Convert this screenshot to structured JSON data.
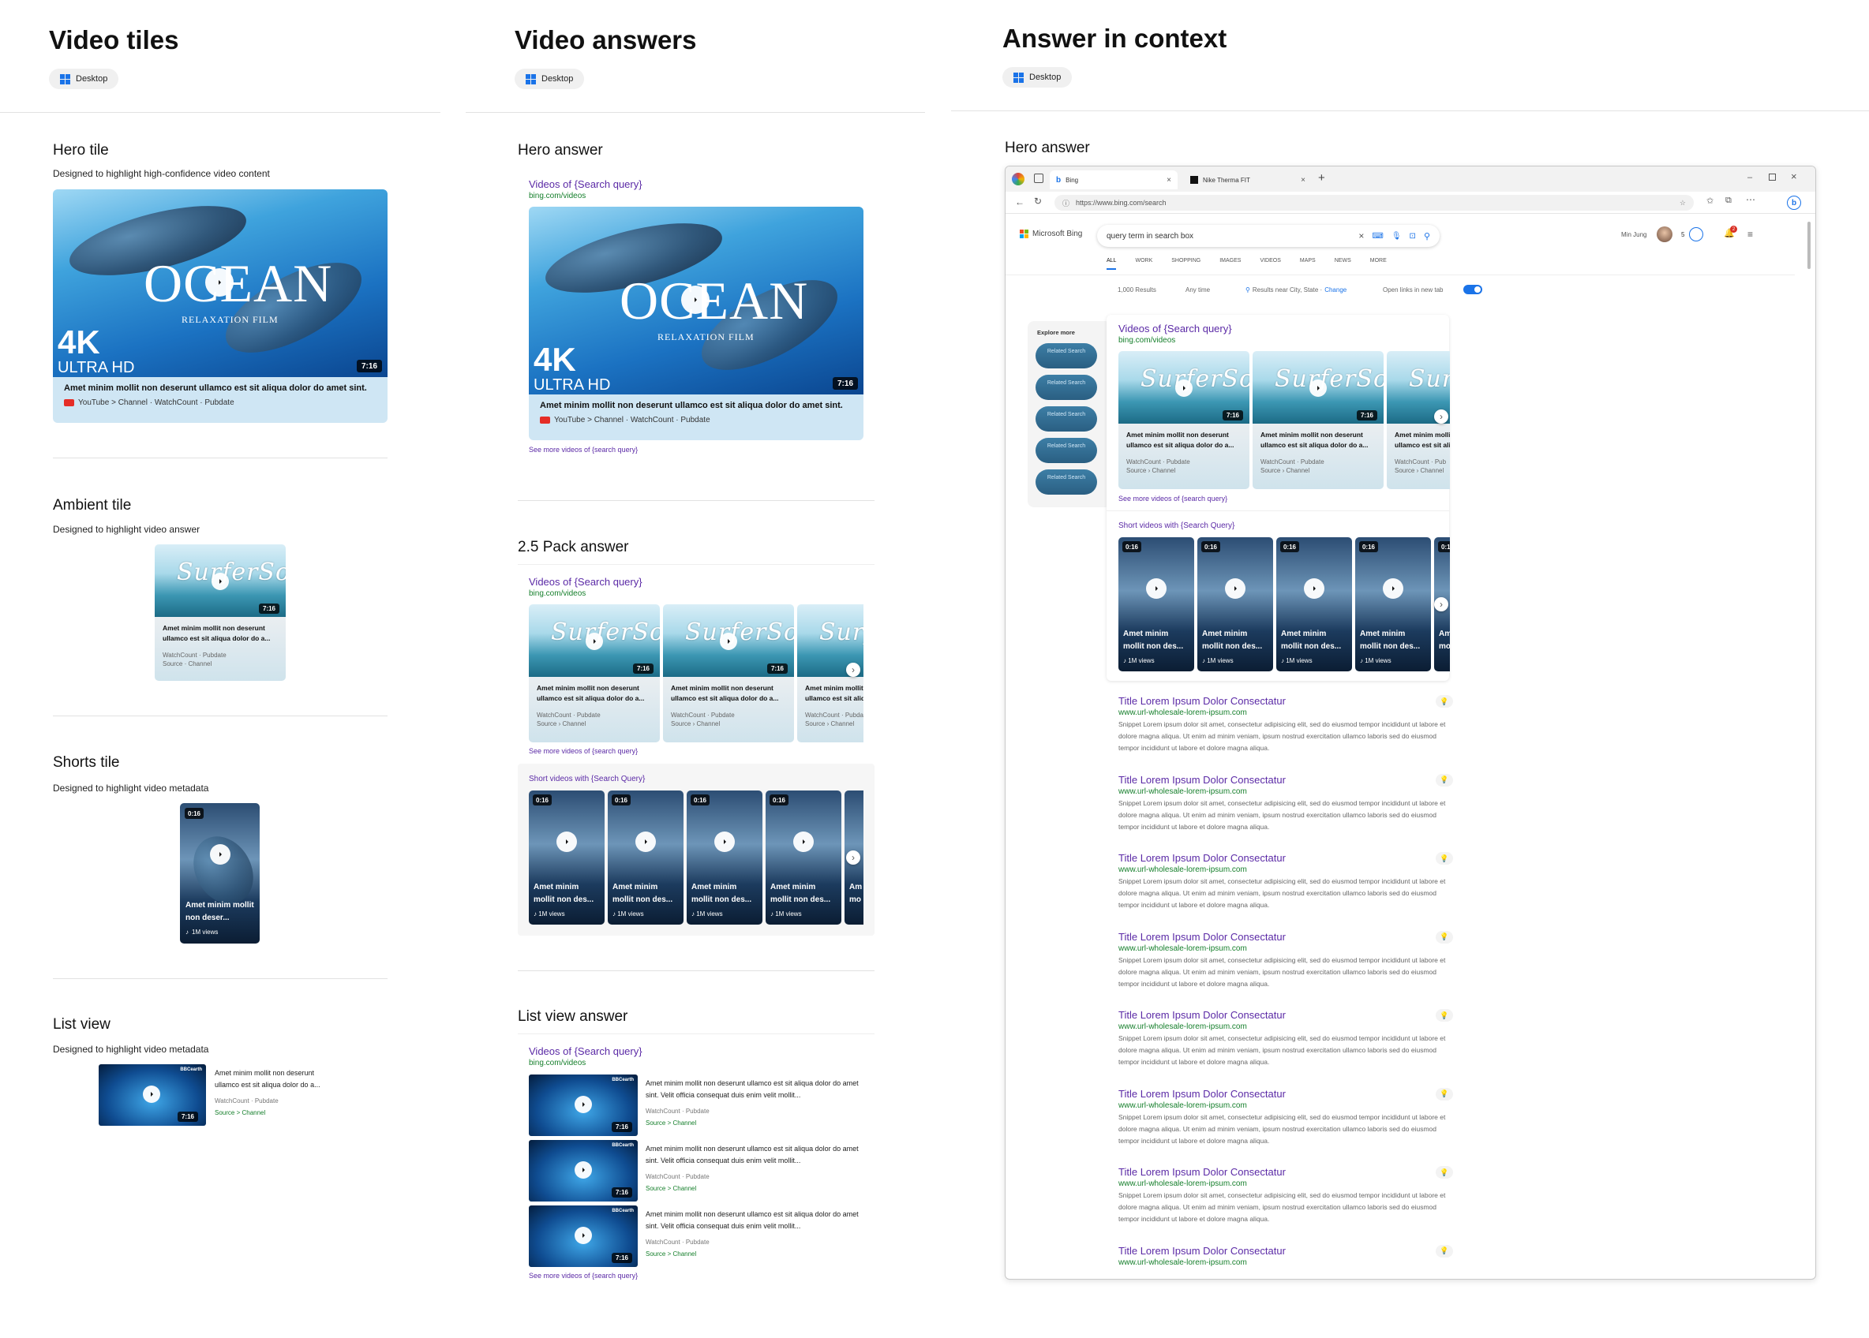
{
  "columns": {
    "video_tiles": {
      "title": "Video tiles",
      "pill": "Desktop"
    },
    "video_answers": {
      "title": "Video answers",
      "pill": "Desktop"
    },
    "answer_in_context": {
      "title": "Answer in context",
      "pill": "Desktop"
    }
  },
  "video_tiles": {
    "hero": {
      "title": "Hero tile",
      "desc": "Designed to highlight high-confidence video content",
      "thumb_title": "OCEAN",
      "thumb_sub": "RELAXATION FILM",
      "badge_big": "4K",
      "badge_small": "ULTRA HD",
      "duration": "7:16",
      "caption": "Amet minim mollit non deserunt ullamco est sit aliqua dolor do amet sint.",
      "meta": "YouTube > Channel · WatchCount · Pubdate"
    },
    "ambient": {
      "title": "Ambient tile",
      "desc": "Designed to highlight video answer",
      "duration": "7:16",
      "caption": "Amet minim mollit non deserunt ullamco est sit aliqua dolor do a...",
      "meta1": "WatchCount · Pubdate",
      "meta2": "Source · Channel"
    },
    "shorts": {
      "title": "Shorts tile",
      "desc": "Designed to highlight video metadata",
      "duration": "0:16",
      "caption": "Amet minim mollit non deser...",
      "views": "1M views"
    },
    "list": {
      "title": "List view",
      "desc": "Designed to highlight video metadata",
      "duration": "7:16",
      "badge": "BBCearth",
      "caption": "Amet minim mollit non deserunt ullamco est sit aliqua dolor do a...",
      "meta": "WatchCount · Pubdate",
      "source": "Source > Channel"
    }
  },
  "video_answers": {
    "hero": {
      "title": "Hero answer",
      "link": "Videos of {Search query}",
      "url": "bing.com/videos",
      "thumb_title": "OCEAN",
      "thumb_sub": "RELAXATION FILM",
      "badge_big": "4K",
      "badge_small": "ULTRA HD",
      "duration": "7:16",
      "caption": "Amet minim mollit non deserunt ullamco est sit aliqua dolor do amet sint.",
      "meta": "YouTube > Channel · WatchCount · Pubdate",
      "see_more": "See more videos of {search query}"
    },
    "pack": {
      "title": "2.5 Pack answer",
      "link": "Videos of {Search query}",
      "url": "bing.com/videos",
      "cards": [
        {
          "duration": "7:16",
          "caption": "Amet minim mollit non deserunt ullamco est sit aliqua dolor do a...",
          "meta1": "WatchCount · Pubdate",
          "meta2": "Source › Channel"
        },
        {
          "duration": "7:16",
          "caption": "Amet minim mollit non deserunt ullamco est sit aliqua dolor do a...",
          "meta1": "WatchCount · Pubdate",
          "meta2": "Source › Channel"
        },
        {
          "duration": "",
          "caption": "Amet minim mollit non deserunt ullamco est sit aliqua dolor do a...",
          "meta1": "WatchCount · Pubdate",
          "meta2": "Source › Channel"
        }
      ],
      "see_more": "See more videos of {search query}",
      "shorts_title": "Short videos with {Search Query}",
      "shorts": [
        {
          "duration": "0:16",
          "caption": "Amet minim mollit non des...",
          "views": "1M views"
        },
        {
          "duration": "0:16",
          "caption": "Amet minim mollit non des...",
          "views": "1M views"
        },
        {
          "duration": "0:16",
          "caption": "Amet minim mollit non des...",
          "views": "1M views"
        },
        {
          "duration": "0:16",
          "caption": "Amet minim mollit non des...",
          "views": "1M views"
        },
        {
          "duration": "",
          "caption": "Am mo",
          "views": ""
        }
      ]
    },
    "list": {
      "title": "List view answer",
      "link": "Videos of {Search query}",
      "url": "bing.com/videos",
      "items": [
        {
          "duration": "7:16",
          "badge": "BBCearth",
          "caption": "Amet minim mollit non deserunt ullamco est sit aliqua dolor do amet sint. Velit officia consequat duis enim velit mollit...",
          "meta": "WatchCount · Pubdate",
          "source": "Source > Channel"
        },
        {
          "duration": "7:16",
          "badge": "BBCearth",
          "caption": "Amet minim mollit non deserunt ullamco est sit aliqua dolor do amet sint. Velit officia consequat duis enim velit mollit...",
          "meta": "WatchCount · Pubdate",
          "source": "Source > Channel"
        },
        {
          "duration": "7:16",
          "badge": "BBCearth",
          "caption": "Amet minim mollit non deserunt ullamco est sit aliqua dolor do amet sint. Velit officia consequat duis enim velit mollit...",
          "meta": "WatchCount · Pubdate",
          "source": "Source > Channel"
        }
      ],
      "see_more": "See more videos of {search query}"
    }
  },
  "context": {
    "title": "Hero answer",
    "browser": {
      "tabs": [
        {
          "label": "Bing"
        },
        {
          "label": "Nike Therma FIT"
        }
      ],
      "address": "https://www.bing.com/search"
    },
    "bing": {
      "logo": "Microsoft Bing",
      "query": "query term in search box",
      "user": "Min Jung",
      "points": "5",
      "notif_count": "2",
      "nav": [
        "ALL",
        "WORK",
        "SHOPPING",
        "IMAGES",
        "VIDEOS",
        "MAPS",
        "NEWS",
        "MORE"
      ],
      "results_count": "1,000 Results",
      "time_filter": "Any time",
      "location": "Results near City, State ·",
      "change": "Change",
      "open_links": "Open links in new tab",
      "explore_more": "Explore more",
      "related": [
        "Related Search",
        "Related Search",
        "Related Search",
        "Related Search",
        "Related Search"
      ],
      "answer_link": "Videos of {Search query}",
      "answer_url": "bing.com/videos",
      "cards": [
        {
          "duration": "7:16",
          "caption": "Amet minim mollit non deserunt ullamco est sit aliqua dolor do a...",
          "meta1": "WatchCount · Pubdate",
          "meta2": "Source › Channel"
        },
        {
          "duration": "7:16",
          "caption": "Amet minim mollit non deserunt ullamco est sit aliqua dolor do a...",
          "meta1": "WatchCount · Pubdate",
          "meta2": "Source › Channel"
        },
        {
          "duration": "",
          "caption": "Amet minim mollit non deserunt ullamco est sit ali",
          "meta1": "WatchCount · Pub",
          "meta2": "Source › Channel"
        }
      ],
      "see_more": "See more videos of {search query}",
      "shorts_title": "Short videos with {Search Query}",
      "shorts": [
        {
          "duration": "0:16",
          "caption": "Amet minim mollit non des...",
          "views": "1M views"
        },
        {
          "duration": "0:16",
          "caption": "Amet minim mollit non des...",
          "views": "1M views"
        },
        {
          "duration": "0:16",
          "caption": "Amet minim mollit non des...",
          "views": "1M views"
        },
        {
          "duration": "0:16",
          "caption": "Amet minim mollit non des...",
          "views": "1M views"
        },
        {
          "duration": "0:16",
          "caption": "Am mo",
          "views": ""
        }
      ],
      "results": [
        {
          "title": "Title Lorem Ipsum Dolor Consectatur",
          "url": "www.url-wholesale-lorem-ipsum.com",
          "snippet": "Snippet Lorem ipsum dolor sit amet, consectetur adipisicing elit, sed do eiusmod tempor incididunt ut labore et dolore magna aliqua. Ut enim ad minim veniam, ipsum nostrud exercitation ullamco laboris sed do eiusmod tempor incididunt ut labore et dolore magna aliqua."
        },
        {
          "title": "Title Lorem Ipsum Dolor Consectatur",
          "url": "www.url-wholesale-lorem-ipsum.com",
          "snippet": "Snippet Lorem ipsum dolor sit amet, consectetur adipisicing elit, sed do eiusmod tempor incididunt ut labore et dolore magna aliqua. Ut enim ad minim veniam, ipsum nostrud exercitation ullamco laboris sed do eiusmod tempor incididunt ut labore et dolore magna aliqua."
        },
        {
          "title": "Title Lorem Ipsum Dolor Consectatur",
          "url": "www.url-wholesale-lorem-ipsum.com",
          "snippet": "Snippet Lorem ipsum dolor sit amet, consectetur adipisicing elit, sed do eiusmod tempor incididunt ut labore et dolore magna aliqua. Ut enim ad minim veniam, ipsum nostrud exercitation ullamco laboris sed do eiusmod tempor incididunt ut labore et dolore magna aliqua."
        },
        {
          "title": "Title Lorem Ipsum Dolor Consectatur",
          "url": "www.url-wholesale-lorem-ipsum.com",
          "snippet": "Snippet Lorem ipsum dolor sit amet, consectetur adipisicing elit, sed do eiusmod tempor incididunt ut labore et dolore magna aliqua. Ut enim ad minim veniam, ipsum nostrud exercitation ullamco laboris sed do eiusmod tempor incididunt ut labore et dolore magna aliqua."
        },
        {
          "title": "Title Lorem Ipsum Dolor Consectatur",
          "url": "www.url-wholesale-lorem-ipsum.com",
          "snippet": "Snippet Lorem ipsum dolor sit amet, consectetur adipisicing elit, sed do eiusmod tempor incididunt ut labore et dolore magna aliqua. Ut enim ad minim veniam, ipsum nostrud exercitation ullamco laboris sed do eiusmod tempor incididunt ut labore et dolore magna aliqua."
        },
        {
          "title": "Title Lorem Ipsum Dolor Consectatur",
          "url": "www.url-wholesale-lorem-ipsum.com",
          "snippet": "Snippet Lorem ipsum dolor sit amet, consectetur adipisicing elit, sed do eiusmod tempor incididunt ut labore et dolore magna aliqua. Ut enim ad minim veniam, ipsum nostrud exercitation ullamco laboris sed do eiusmod tempor incididunt ut labore et dolore magna aliqua."
        },
        {
          "title": "Title Lorem Ipsum Dolor Consectatur",
          "url": "www.url-wholesale-lorem-ipsum.com",
          "snippet": "Snippet Lorem ipsum dolor sit amet, consectetur adipisicing elit, sed do eiusmod tempor incididunt ut labore et dolore magna aliqua. Ut enim ad minim veniam, ipsum nostrud exercitation ullamco laboris sed do eiusmod tempor incididunt ut labore et dolore magna aliqua."
        },
        {
          "title": "Title Lorem Ipsum Dolor Consectatur",
          "url": "www.url-wholesale-lorem-ipsum.com",
          "snippet": ""
        }
      ]
    }
  },
  "colors": {
    "link_purple": "#5b2aa6",
    "url_green": "#157f2b",
    "accent_blue": "#1a73e8"
  }
}
